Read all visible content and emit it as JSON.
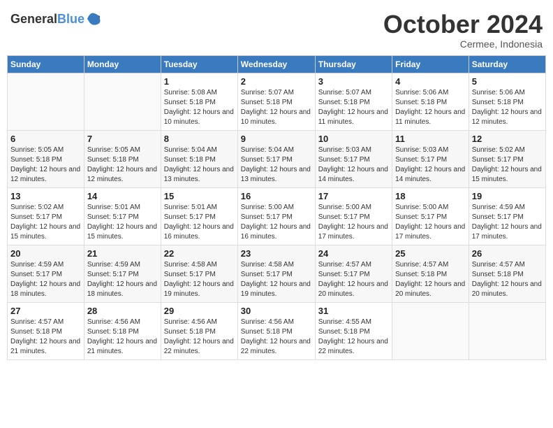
{
  "header": {
    "logo_general": "General",
    "logo_blue": "Blue",
    "month_title": "October 2024",
    "location": "Cermee, Indonesia"
  },
  "columns": [
    "Sunday",
    "Monday",
    "Tuesday",
    "Wednesday",
    "Thursday",
    "Friday",
    "Saturday"
  ],
  "weeks": [
    [
      {
        "day": "",
        "info": ""
      },
      {
        "day": "",
        "info": ""
      },
      {
        "day": "1",
        "info": "Sunrise: 5:08 AM\nSunset: 5:18 PM\nDaylight: 12 hours and 10 minutes."
      },
      {
        "day": "2",
        "info": "Sunrise: 5:07 AM\nSunset: 5:18 PM\nDaylight: 12 hours and 10 minutes."
      },
      {
        "day": "3",
        "info": "Sunrise: 5:07 AM\nSunset: 5:18 PM\nDaylight: 12 hours and 11 minutes."
      },
      {
        "day": "4",
        "info": "Sunrise: 5:06 AM\nSunset: 5:18 PM\nDaylight: 12 hours and 11 minutes."
      },
      {
        "day": "5",
        "info": "Sunrise: 5:06 AM\nSunset: 5:18 PM\nDaylight: 12 hours and 12 minutes."
      }
    ],
    [
      {
        "day": "6",
        "info": "Sunrise: 5:05 AM\nSunset: 5:18 PM\nDaylight: 12 hours and 12 minutes."
      },
      {
        "day": "7",
        "info": "Sunrise: 5:05 AM\nSunset: 5:18 PM\nDaylight: 12 hours and 12 minutes."
      },
      {
        "day": "8",
        "info": "Sunrise: 5:04 AM\nSunset: 5:18 PM\nDaylight: 12 hours and 13 minutes."
      },
      {
        "day": "9",
        "info": "Sunrise: 5:04 AM\nSunset: 5:17 PM\nDaylight: 12 hours and 13 minutes."
      },
      {
        "day": "10",
        "info": "Sunrise: 5:03 AM\nSunset: 5:17 PM\nDaylight: 12 hours and 14 minutes."
      },
      {
        "day": "11",
        "info": "Sunrise: 5:03 AM\nSunset: 5:17 PM\nDaylight: 12 hours and 14 minutes."
      },
      {
        "day": "12",
        "info": "Sunrise: 5:02 AM\nSunset: 5:17 PM\nDaylight: 12 hours and 15 minutes."
      }
    ],
    [
      {
        "day": "13",
        "info": "Sunrise: 5:02 AM\nSunset: 5:17 PM\nDaylight: 12 hours and 15 minutes."
      },
      {
        "day": "14",
        "info": "Sunrise: 5:01 AM\nSunset: 5:17 PM\nDaylight: 12 hours and 15 minutes."
      },
      {
        "day": "15",
        "info": "Sunrise: 5:01 AM\nSunset: 5:17 PM\nDaylight: 12 hours and 16 minutes."
      },
      {
        "day": "16",
        "info": "Sunrise: 5:00 AM\nSunset: 5:17 PM\nDaylight: 12 hours and 16 minutes."
      },
      {
        "day": "17",
        "info": "Sunrise: 5:00 AM\nSunset: 5:17 PM\nDaylight: 12 hours and 17 minutes."
      },
      {
        "day": "18",
        "info": "Sunrise: 5:00 AM\nSunset: 5:17 PM\nDaylight: 12 hours and 17 minutes."
      },
      {
        "day": "19",
        "info": "Sunrise: 4:59 AM\nSunset: 5:17 PM\nDaylight: 12 hours and 17 minutes."
      }
    ],
    [
      {
        "day": "20",
        "info": "Sunrise: 4:59 AM\nSunset: 5:17 PM\nDaylight: 12 hours and 18 minutes."
      },
      {
        "day": "21",
        "info": "Sunrise: 4:59 AM\nSunset: 5:17 PM\nDaylight: 12 hours and 18 minutes."
      },
      {
        "day": "22",
        "info": "Sunrise: 4:58 AM\nSunset: 5:17 PM\nDaylight: 12 hours and 19 minutes."
      },
      {
        "day": "23",
        "info": "Sunrise: 4:58 AM\nSunset: 5:17 PM\nDaylight: 12 hours and 19 minutes."
      },
      {
        "day": "24",
        "info": "Sunrise: 4:57 AM\nSunset: 5:17 PM\nDaylight: 12 hours and 20 minutes."
      },
      {
        "day": "25",
        "info": "Sunrise: 4:57 AM\nSunset: 5:18 PM\nDaylight: 12 hours and 20 minutes."
      },
      {
        "day": "26",
        "info": "Sunrise: 4:57 AM\nSunset: 5:18 PM\nDaylight: 12 hours and 20 minutes."
      }
    ],
    [
      {
        "day": "27",
        "info": "Sunrise: 4:57 AM\nSunset: 5:18 PM\nDaylight: 12 hours and 21 minutes."
      },
      {
        "day": "28",
        "info": "Sunrise: 4:56 AM\nSunset: 5:18 PM\nDaylight: 12 hours and 21 minutes."
      },
      {
        "day": "29",
        "info": "Sunrise: 4:56 AM\nSunset: 5:18 PM\nDaylight: 12 hours and 22 minutes."
      },
      {
        "day": "30",
        "info": "Sunrise: 4:56 AM\nSunset: 5:18 PM\nDaylight: 12 hours and 22 minutes."
      },
      {
        "day": "31",
        "info": "Sunrise: 4:55 AM\nSunset: 5:18 PM\nDaylight: 12 hours and 22 minutes."
      },
      {
        "day": "",
        "info": ""
      },
      {
        "day": "",
        "info": ""
      }
    ]
  ]
}
